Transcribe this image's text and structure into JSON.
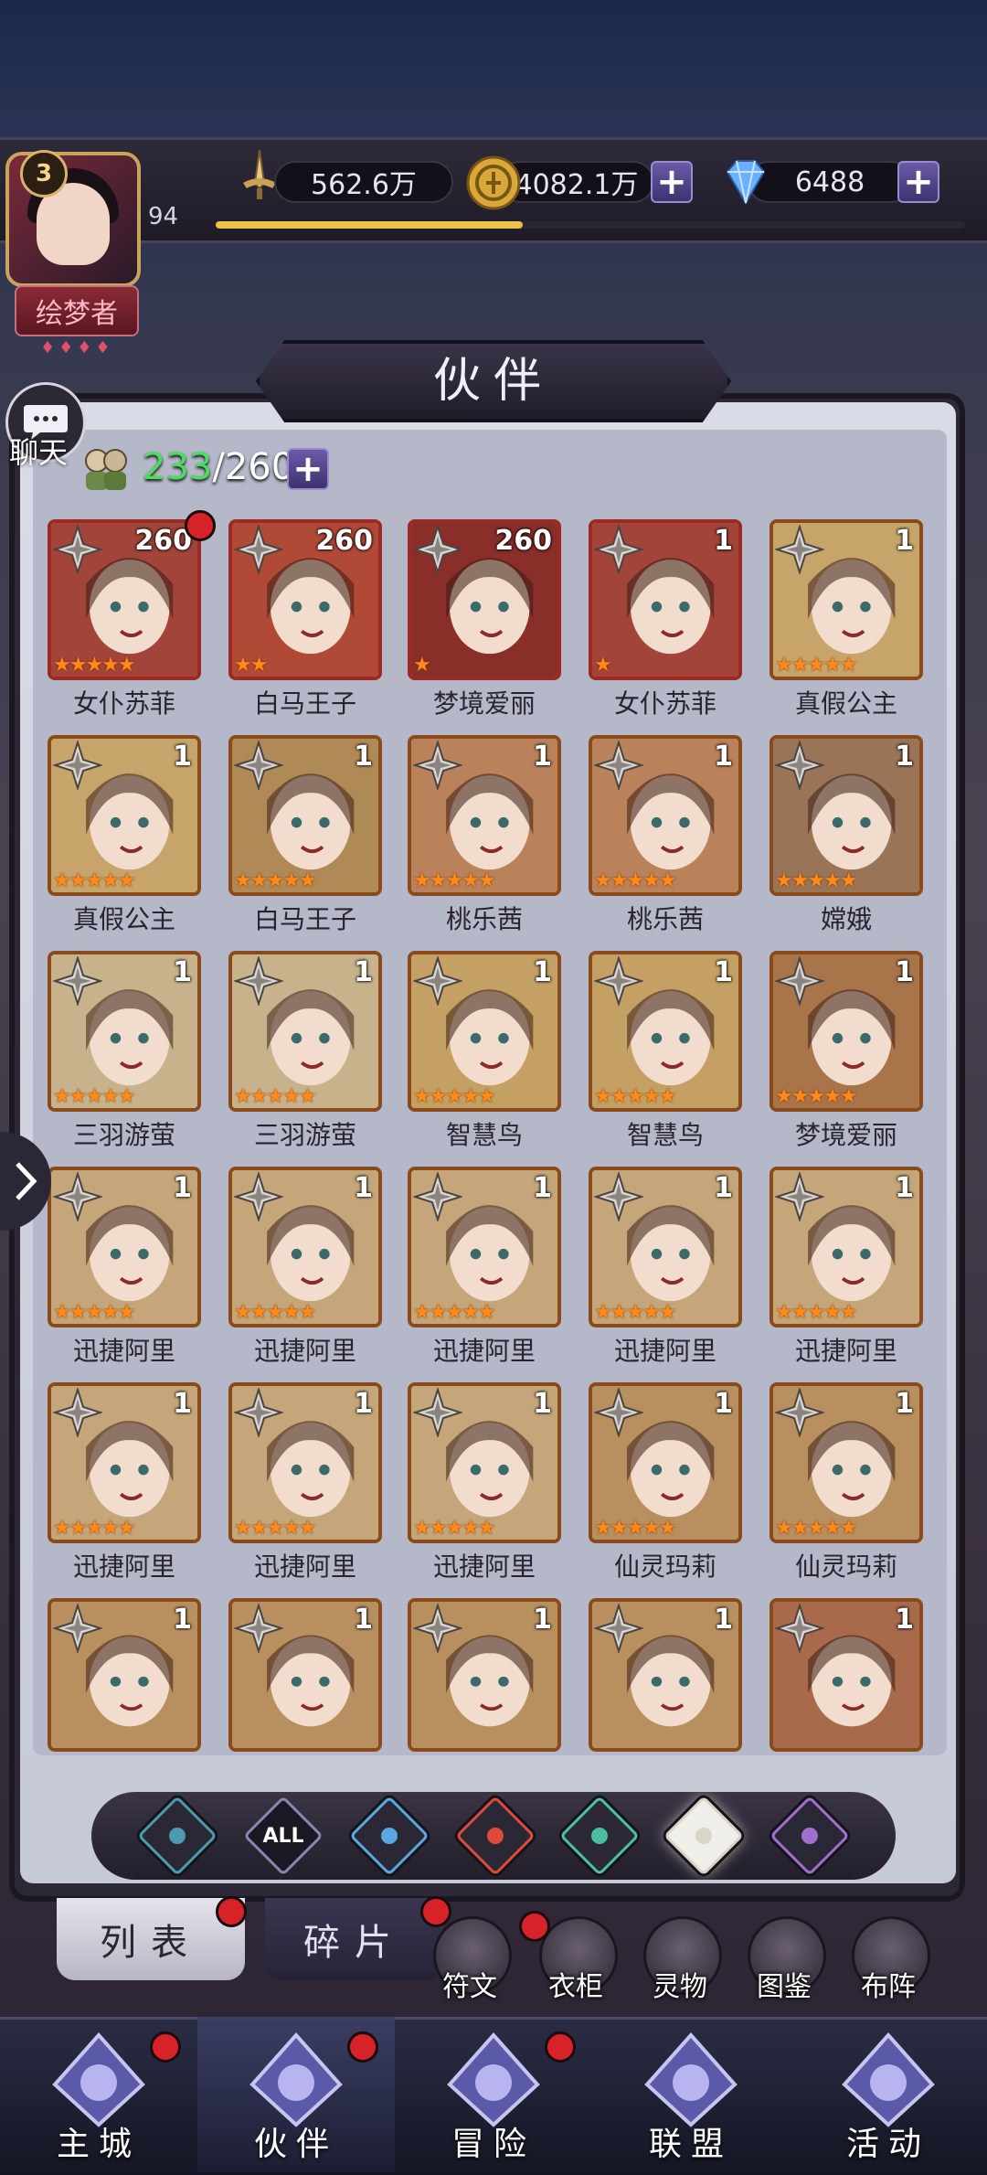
{
  "player": {
    "vip_level": "3",
    "level": "94",
    "title": "绘梦者",
    "title_gems": "♦♦♦♦"
  },
  "resources": {
    "power": "562.6万",
    "gold": "4082.1万",
    "gems": "6488",
    "exp_fraction": 0.41
  },
  "page": {
    "title": "伙伴",
    "chat_label": "聊天",
    "partner_count_current": "233",
    "partner_count_max": "/260"
  },
  "cards": [
    {
      "name": "女仆苏菲",
      "num": "260",
      "stars": 5,
      "reddot": true,
      "frame": "red",
      "hue": "#a2443a"
    },
    {
      "name": "白马王子",
      "num": "260",
      "stars": 2,
      "reddot": false,
      "frame": "red",
      "hue": "#b04a36"
    },
    {
      "name": "梦境爱丽",
      "num": "260",
      "stars": 1,
      "reddot": false,
      "frame": "red",
      "hue": "#8a2e2a"
    },
    {
      "name": "女仆苏菲",
      "num": "1",
      "stars": 1,
      "reddot": false,
      "frame": "red",
      "hue": "#a2443a"
    },
    {
      "name": "真假公主",
      "num": "1",
      "stars": 5,
      "reddot": false,
      "frame": "gold",
      "hue": "#c6a46a"
    },
    {
      "name": "真假公主",
      "num": "1",
      "stars": 5,
      "reddot": false,
      "frame": "gold",
      "hue": "#c6a46a"
    },
    {
      "name": "白马王子",
      "num": "1",
      "stars": 5,
      "reddot": false,
      "frame": "gold",
      "hue": "#b08a56"
    },
    {
      "name": "桃乐茜",
      "num": "1",
      "stars": 5,
      "reddot": false,
      "frame": "gold",
      "hue": "#b9825a"
    },
    {
      "name": "桃乐茜",
      "num": "1",
      "stars": 5,
      "reddot": false,
      "frame": "gold",
      "hue": "#b9825a"
    },
    {
      "name": "嫦娥",
      "num": "1",
      "stars": 5,
      "reddot": false,
      "frame": "gold",
      "hue": "#9a7456"
    },
    {
      "name": "三羽游萤",
      "num": "1",
      "stars": 5,
      "reddot": false,
      "frame": "gold",
      "hue": "#c8b28c"
    },
    {
      "name": "三羽游萤",
      "num": "1",
      "stars": 5,
      "reddot": false,
      "frame": "gold",
      "hue": "#c8b28c"
    },
    {
      "name": "智慧鸟",
      "num": "1",
      "stars": 5,
      "reddot": false,
      "frame": "gold",
      "hue": "#c4a064"
    },
    {
      "name": "智慧鸟",
      "num": "1",
      "stars": 5,
      "reddot": false,
      "frame": "gold",
      "hue": "#c4a064"
    },
    {
      "name": "梦境爱丽",
      "num": "1",
      "stars": 5,
      "reddot": false,
      "frame": "gold",
      "hue": "#a8744a"
    },
    {
      "name": "迅捷阿里",
      "num": "1",
      "stars": 5,
      "reddot": false,
      "frame": "gold",
      "hue": "#c4a67a"
    },
    {
      "name": "迅捷阿里",
      "num": "1",
      "stars": 5,
      "reddot": false,
      "frame": "gold",
      "hue": "#c4a67a"
    },
    {
      "name": "迅捷阿里",
      "num": "1",
      "stars": 5,
      "reddot": false,
      "frame": "gold",
      "hue": "#c4a67a"
    },
    {
      "name": "迅捷阿里",
      "num": "1",
      "stars": 5,
      "reddot": false,
      "frame": "gold",
      "hue": "#c4a67a"
    },
    {
      "name": "迅捷阿里",
      "num": "1",
      "stars": 5,
      "reddot": false,
      "frame": "gold",
      "hue": "#c4a67a"
    },
    {
      "name": "迅捷阿里",
      "num": "1",
      "stars": 5,
      "reddot": false,
      "frame": "gold",
      "hue": "#c4a67a"
    },
    {
      "name": "迅捷阿里",
      "num": "1",
      "stars": 5,
      "reddot": false,
      "frame": "gold",
      "hue": "#c4a67a"
    },
    {
      "name": "迅捷阿里",
      "num": "1",
      "stars": 5,
      "reddot": false,
      "frame": "gold",
      "hue": "#c4a67a"
    },
    {
      "name": "仙灵玛莉",
      "num": "1",
      "stars": 5,
      "reddot": false,
      "frame": "gold",
      "hue": "#b89060"
    },
    {
      "name": "仙灵玛莉",
      "num": "1",
      "stars": 5,
      "reddot": false,
      "frame": "gold",
      "hue": "#b89060"
    },
    {
      "name": "",
      "num": "1",
      "stars": 0,
      "reddot": false,
      "frame": "gold",
      "hue": "#b89060"
    },
    {
      "name": "",
      "num": "1",
      "stars": 0,
      "reddot": false,
      "frame": "gold",
      "hue": "#b89060"
    },
    {
      "name": "",
      "num": "1",
      "stars": 0,
      "reddot": false,
      "frame": "gold",
      "hue": "#b89060"
    },
    {
      "name": "",
      "num": "1",
      "stars": 0,
      "reddot": false,
      "frame": "gold",
      "hue": "#b89060"
    },
    {
      "name": "",
      "num": "1",
      "stars": 0,
      "reddot": false,
      "frame": "gold",
      "hue": "#a86a4a"
    }
  ],
  "filters": [
    {
      "icon": "water-element-icon",
      "color": "#4a9ab0"
    },
    {
      "icon": "all-filter-icon",
      "label": "ALL",
      "color": "#8a86b0"
    },
    {
      "icon": "droplet-element-icon",
      "color": "#5aa8e0"
    },
    {
      "icon": "fire-element-icon",
      "color": "#e04a3a"
    },
    {
      "icon": "wind-element-icon",
      "color": "#4ac0a0"
    },
    {
      "icon": "star-element-icon",
      "color": "#d8d4c8",
      "active": true
    },
    {
      "icon": "eye-element-icon",
      "color": "#a070d0"
    }
  ],
  "tabs": {
    "list": "列表",
    "fragments": "碎片"
  },
  "sub_menu": [
    {
      "label": "符文",
      "icon": "rune-icon"
    },
    {
      "label": "衣柜",
      "icon": "wardrobe-icon"
    },
    {
      "label": "灵物",
      "icon": "spirit-object-icon"
    },
    {
      "label": "图鉴",
      "icon": "codex-icon"
    },
    {
      "label": "布阵",
      "icon": "formation-icon"
    }
  ],
  "nav": [
    {
      "label": "主城",
      "icon": "castle-icon",
      "reddot": true
    },
    {
      "label": "伙伴",
      "icon": "partner-hat-icon",
      "reddot": true,
      "active": true
    },
    {
      "label": "冒险",
      "icon": "compass-icon",
      "reddot": true
    },
    {
      "label": "联盟",
      "icon": "shield-icon",
      "reddot": false
    },
    {
      "label": "活动",
      "icon": "cards-icon",
      "reddot": false
    }
  ],
  "colors": {
    "accent_gold": "#e8c24a",
    "count_green": "#4adf5a",
    "reddot": "#d8222a",
    "star_orange": "#ff8a1a"
  }
}
